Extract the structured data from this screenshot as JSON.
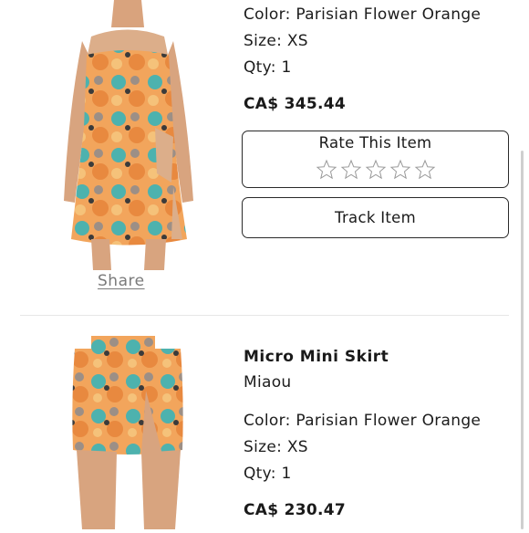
{
  "item1": {
    "color": "Color: Parisian Flower Orange",
    "size": "Size: XS",
    "qty": "Qty: 1",
    "price": "CA$ 345.44",
    "rate_label": "Rate This Item",
    "rating": 0,
    "rating_max": 5,
    "track_label": "Track Item",
    "share_label": "Share"
  },
  "item2": {
    "title": "Micro Mini Skirt",
    "brand": "Miaou",
    "color": "Color: Parisian Flower Orange",
    "size": "Size: XS",
    "qty": "Qty: 1",
    "price": "CA$ 230.47"
  },
  "colors": {
    "text": "#1a1a1a",
    "link": "#7a7a7a",
    "border": "#2a2a2a",
    "print_orange": "#f3a25a",
    "print_teal": "#4fb3b0"
  },
  "icons": [
    "star-outline-icon"
  ]
}
